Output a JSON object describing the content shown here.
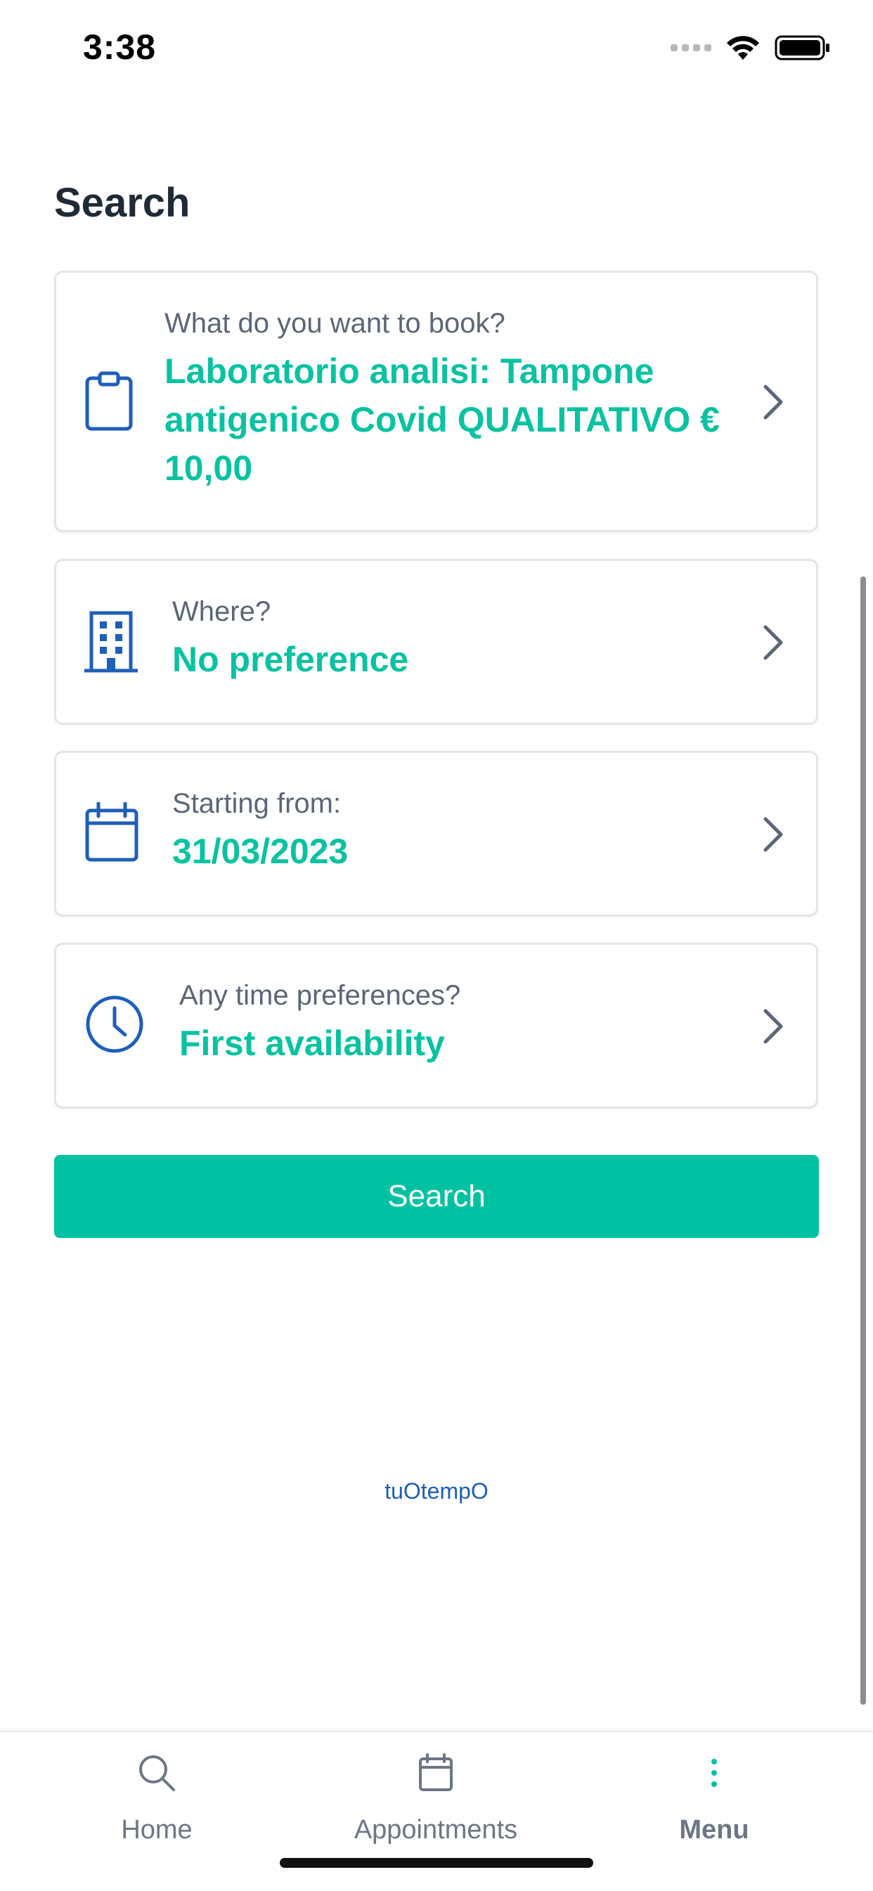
{
  "status_bar": {
    "time": "3:38"
  },
  "page": {
    "title": "Search"
  },
  "cards": {
    "what": {
      "label": "What do you want to book?",
      "value_lines": [
        "Laboratorio analisi: Tampone",
        "antigenico Covid QUALITATIVO €",
        "10,00"
      ],
      "icon": "clipboard-icon"
    },
    "where": {
      "label": "Where?",
      "value": "No preference",
      "icon": "building-icon"
    },
    "start": {
      "label": "Starting from:",
      "value": "31/03/2023",
      "icon": "calendar-icon"
    },
    "time": {
      "label": "Any time preferences?",
      "value": "First availability",
      "icon": "clock-icon"
    }
  },
  "search_button": {
    "label": "Search"
  },
  "brand": {
    "text": "tuOtempO"
  },
  "tab_bar": {
    "tabs": [
      {
        "label": "Home",
        "icon": "search-icon",
        "active": false
      },
      {
        "label": "Appointments",
        "icon": "calendar-icon",
        "active": false
      },
      {
        "label": "Menu",
        "icon": "more-vertical-icon",
        "active": true
      }
    ]
  },
  "colors": {
    "accent": "#00c2a2",
    "icon_blue": "#1e5fb8",
    "label_gray": "#5b6676",
    "title": "#1f2a37"
  }
}
